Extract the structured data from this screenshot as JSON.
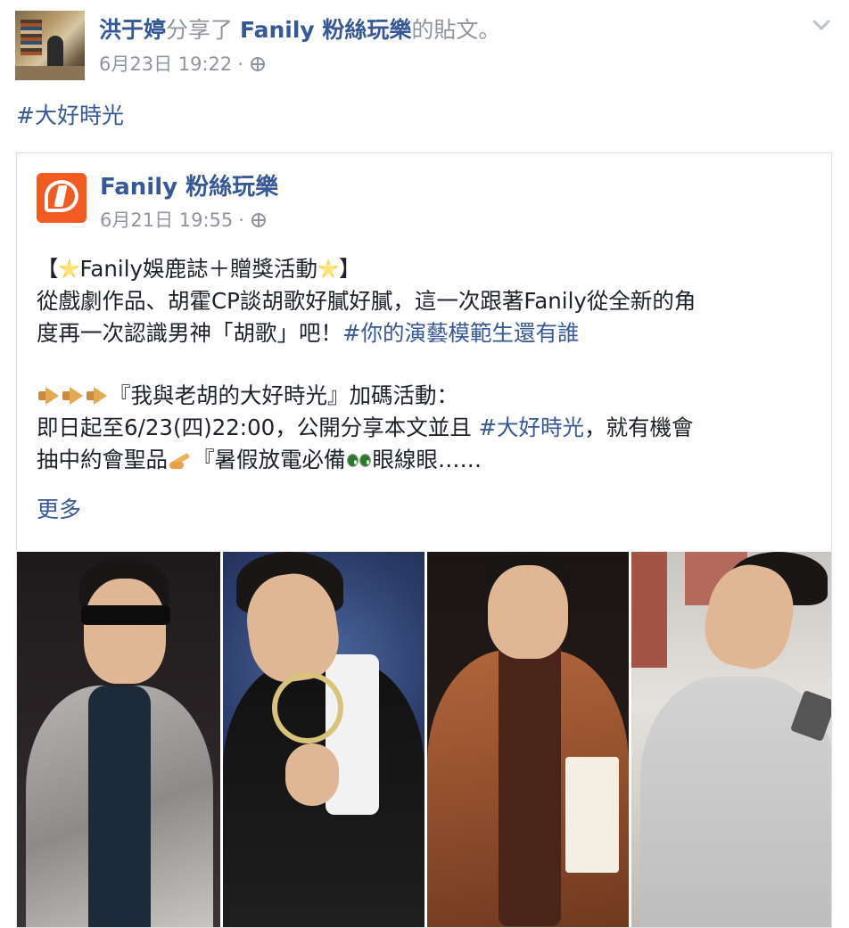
{
  "header": {
    "sharer_name": "洪于婷",
    "shared_text": "分享了",
    "page_name": "Fanily 粉絲玩樂",
    "suffix_text": "的貼文。",
    "timestamp": "6月23日 19:22",
    "separator": "·",
    "privacy_icon": "globe-icon",
    "menu_icon": "chevron-down-icon"
  },
  "caption": {
    "hashtag": "#大好時光"
  },
  "shared_post": {
    "page_name": "Fanily 粉絲玩樂",
    "timestamp": "6月21日 19:55",
    "separator": "·",
    "logo_color": "#f25a22",
    "body": {
      "line1_open": "【",
      "line1_text": "Fanily娛鹿誌＋贈獎活動",
      "line1_close": "】",
      "line2": "從戲劇作品、胡霍CP談胡歌好膩好膩，這一次跟著Fanily從全新的角",
      "line3_text": "度再一次認識男神「胡歌」吧！",
      "line3_tag": "#你的演藝模範生還有誰",
      "line4": "『我與老胡的大好時光』加碼活動：",
      "line5_a": "即日起至6/23(四)22:00，公開分享本文並且 ",
      "line5_tag": "#大好時光",
      "line5_b": "，就有機會",
      "line6_a": "抽中約會聖品",
      "line6_b": "『暑假放電必備",
      "line6_c": "眼線眼……"
    },
    "see_more": "更多",
    "photos": [
      "photo-1",
      "photo-2",
      "photo-3",
      "photo-4"
    ]
  },
  "colors": {
    "link": "#365899",
    "muted": "#90949c",
    "text": "#1d2129",
    "border": "#dddfe2"
  }
}
